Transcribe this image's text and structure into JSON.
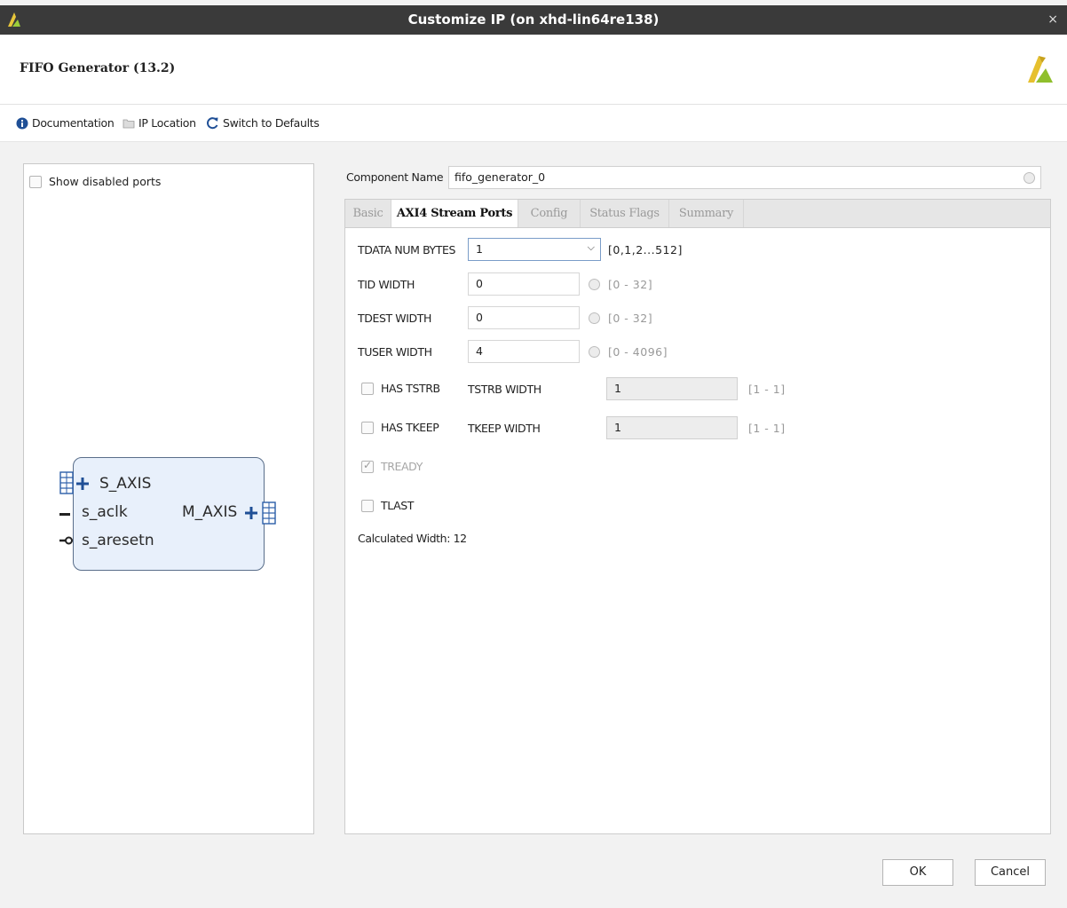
{
  "window": {
    "title": "Customize IP (on xhd-lin64re138)",
    "close_glyph": "×"
  },
  "header": {
    "ip_name": "FIFO Generator (13.2)"
  },
  "toolbar": {
    "documentation": "Documentation",
    "ip_location": "IP Location",
    "switch_defaults": "Switch to Defaults"
  },
  "left_panel": {
    "show_disabled_ports": "Show disabled ports",
    "ports": {
      "s_axis": "S_AXIS",
      "s_aclk": "s_aclk",
      "s_aresetn": "s_aresetn",
      "m_axis": "M_AXIS"
    }
  },
  "component": {
    "label": "Component Name",
    "value": "fifo_generator_0"
  },
  "tabs": [
    {
      "label": "Basic"
    },
    {
      "label": "AXI4 Stream Ports"
    },
    {
      "label": "Config"
    },
    {
      "label": "Status Flags"
    },
    {
      "label": "Summary"
    }
  ],
  "stream_ports": {
    "tdata_num_bytes": {
      "label": "TDATA NUM BYTES",
      "value": "1",
      "range": "[0,1,2...512]"
    },
    "tid_width": {
      "label": "TID WIDTH",
      "value": "0",
      "range": "[0 - 32]"
    },
    "tdest_width": {
      "label": "TDEST WIDTH",
      "value": "0",
      "range": "[0 - 32]"
    },
    "tuser_width": {
      "label": "TUSER WIDTH",
      "value": "4",
      "range": "[0 - 4096]"
    },
    "has_tstrb": {
      "label": "HAS TSTRB",
      "checked": false,
      "width_label": "TSTRB WIDTH",
      "width_value": "1",
      "range": "[1 - 1]"
    },
    "has_tkeep": {
      "label": "HAS TKEEP",
      "checked": false,
      "width_label": "TKEEP WIDTH",
      "width_value": "1",
      "range": "[1 - 1]"
    },
    "tready": {
      "label": "TREADY",
      "checked": true,
      "disabled": true
    },
    "tlast": {
      "label": "TLAST",
      "checked": false
    },
    "calculated_width": "Calculated Width: 12"
  },
  "buttons": {
    "ok": "OK",
    "cancel": "Cancel"
  },
  "colors": {
    "titlebar": "#3a3a3a",
    "symbol_fill": "#e8f0fb",
    "symbol_border": "#5a6e8a",
    "port_blue": "#2b5ea8",
    "info_blue": "#1f4f96"
  }
}
